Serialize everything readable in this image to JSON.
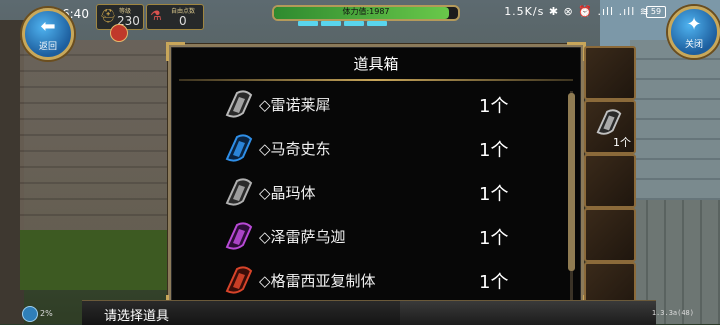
{
  "status_bar": {
    "time": "上午6:40",
    "right_info": "1.5K/s ✱ ⊗ ⏰ .ıll .ıll ≋",
    "battery": "59"
  },
  "hud": {
    "back_label": "返回",
    "close_label": "关闭",
    "level_label": "等级",
    "level_value": "230",
    "stat2_label": "自由点数",
    "stat2_value": "0",
    "hp_text": "体力值:1987",
    "hp_fraction": 0.95
  },
  "panel": {
    "title": "道具箱",
    "items": [
      {
        "name": "◇雷诺莱犀",
        "qty": "1个",
        "color": "#b9b9b9"
      },
      {
        "name": "◇马奇史东",
        "qty": "1个",
        "color": "#2f8fe8"
      },
      {
        "name": "◇晶玛体",
        "qty": "1个",
        "color": "#b0b0b0"
      },
      {
        "name": "◇泽雷萨乌迦",
        "qty": "1个",
        "color": "#b84ad6"
      },
      {
        "name": "◇格雷西亚复制体",
        "qty": "1个",
        "color": "#d8442a"
      }
    ]
  },
  "slots": [
    {
      "qty": ""
    },
    {
      "qty": "1个",
      "has_item": true
    },
    {
      "qty": ""
    },
    {
      "qty": ""
    },
    {
      "qty": ""
    }
  ],
  "bottom": {
    "prompt": "请选择道具",
    "network": "2%",
    "version": "1.3.3a(48)"
  }
}
